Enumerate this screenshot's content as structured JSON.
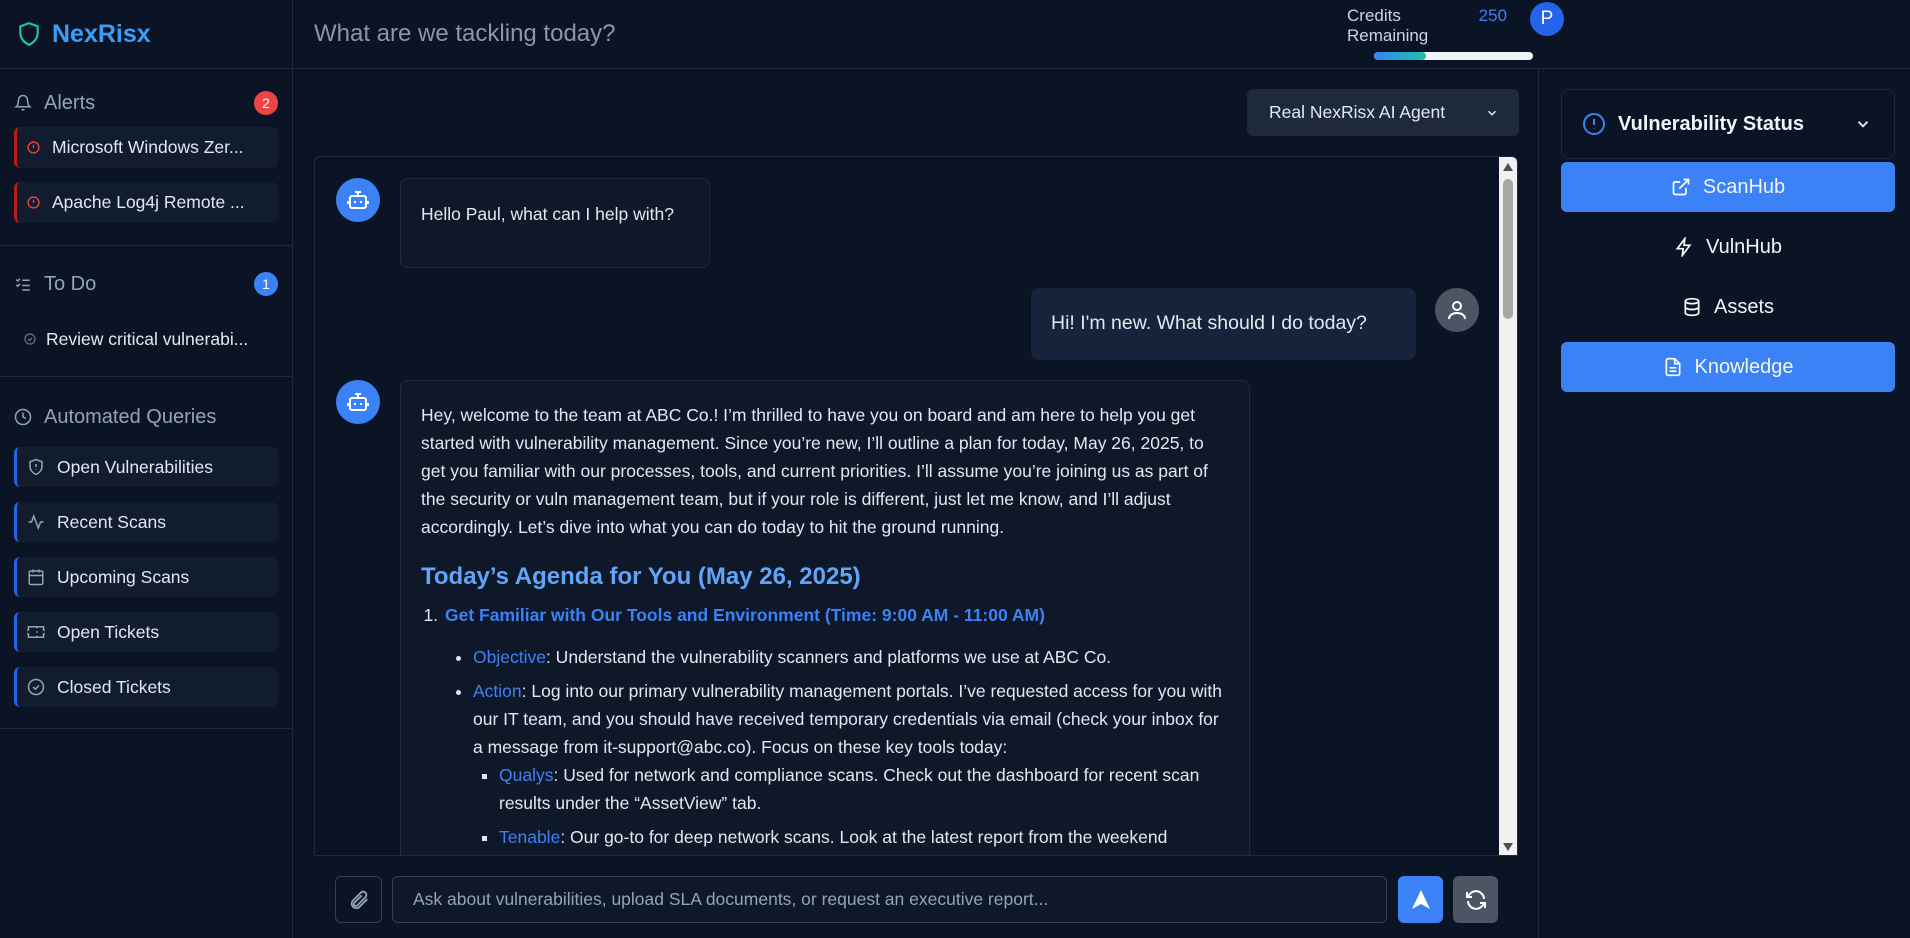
{
  "brand": {
    "name": "NexRisx"
  },
  "topbar": {
    "task_placeholder": "What are we tackling today?",
    "credits_label": "Credits Remaining",
    "credits_value": "250",
    "credits_progress": 0.33,
    "avatar_initial": "P"
  },
  "sidebar": {
    "alerts": {
      "title": "Alerts",
      "count": "2",
      "items": [
        {
          "label": "Microsoft Windows Zer..."
        },
        {
          "label": "Apache Log4j Remote ..."
        }
      ]
    },
    "todo": {
      "title": "To Do",
      "count": "1",
      "items": [
        {
          "label": "Review critical vulnerabi..."
        }
      ]
    },
    "queries": {
      "title": "Automated Queries",
      "items": [
        {
          "label": "Open Vulnerabilities",
          "icon": "shield-icon"
        },
        {
          "label": "Recent Scans",
          "icon": "activity-icon"
        },
        {
          "label": "Upcoming Scans",
          "icon": "calendar-icon"
        },
        {
          "label": "Open Tickets",
          "icon": "ticket-icon"
        },
        {
          "label": "Closed Tickets",
          "icon": "check-circle-icon"
        }
      ]
    }
  },
  "chat": {
    "agent_select": "Real NexRisx AI Agent",
    "messages": {
      "bot_greeting": "Hello Paul, what can I help with?",
      "user_question": "Hi! I'm new. What should I do today?",
      "bot_intro": "Hey, welcome to the team at ABC Co.! I’m thrilled to have you on board and am here to help you get started with vulnerability management. Since you’re new, I’ll outline a plan for today, May 26, 2025, to get you familiar with our processes, tools, and current priorities. I’ll assume you’re joining us as part of the security or vuln management team, but if your role is different, just let me know, and I’ll adjust accordingly. Let’s dive into what you can do today to hit the ground running.",
      "agenda_title": "Today’s Agenda for You (May 26, 2025)",
      "step1_title": "Get Familiar with Our Tools and Environment (Time: 9:00 AM - 11:00 AM)",
      "objective_label": "Objective",
      "objective_text": ": Understand the vulnerability scanners and platforms we use at ABC Co.",
      "action_label": "Action",
      "action_text": ": Log into our primary vulnerability management portals. I’ve requested access for you with our IT team, and you should have received temporary credentials via email (check your inbox for a message from it-support@abc.co). Focus on these key tools today:",
      "qualys_label": "Qualys",
      "qualys_text": ": Used for network and compliance scans. Check out the dashboard for recent scan results under the “AssetView” tab.",
      "tenable_label": "Tenable",
      "tenable_text": ": Our go-to for deep network scans. Look at the latest report from the weekend"
    },
    "input_placeholder": "Ask about vulnerabilities, upload SLA documents, or request an executive report..."
  },
  "right_panel": {
    "status_title": "Vulnerability Status",
    "nav": [
      {
        "label": "ScanHub",
        "active": true
      },
      {
        "label": "VulnHub",
        "active": false
      },
      {
        "label": "Assets",
        "active": false
      },
      {
        "label": "Knowledge",
        "active": true
      }
    ]
  },
  "colors": {
    "accent": "#3b82f6",
    "background": "#0b1424",
    "alert_badge": "#ef4444"
  }
}
